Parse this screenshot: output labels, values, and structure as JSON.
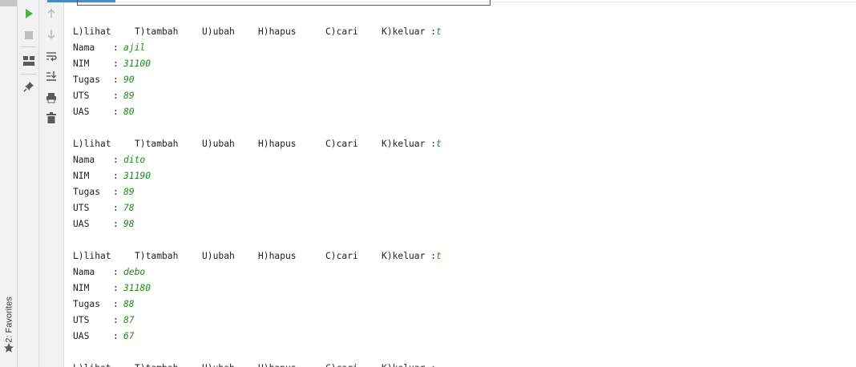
{
  "favorites": {
    "label": "2: Favorites",
    "icon": "star-icon"
  },
  "toolbar_left": [
    {
      "name": "run-button",
      "icon": "play-icon",
      "color": "#4caf50"
    },
    {
      "name": "stop-button",
      "icon": "stop-icon",
      "color": "#bdbdbd"
    },
    {
      "name": "layout-button",
      "icon": "layout-icon"
    },
    {
      "name": "pin-button",
      "icon": "pin-icon"
    }
  ],
  "toolbar_right": [
    {
      "name": "scroll-up-button",
      "icon": "arrow-up-icon"
    },
    {
      "name": "scroll-down-button",
      "icon": "arrow-down-icon"
    },
    {
      "name": "soft-wrap-button",
      "icon": "soft-wrap-icon"
    },
    {
      "name": "scroll-to-end-button",
      "icon": "scroll-to-end-icon"
    },
    {
      "name": "print-button",
      "icon": "print-icon"
    },
    {
      "name": "clear-all-button",
      "icon": "trash-icon"
    }
  ],
  "menu": {
    "lihat": "L)lihat",
    "tambah": "T)tambah",
    "ubah": "U)ubah",
    "hapus": "H)hapus",
    "cari": "C)cari",
    "keluar": "K)keluar :"
  },
  "labels": {
    "nama": "Nama",
    "nim": "NIM",
    "tugas": "Tugas",
    "uts": "UTS",
    "uas": "UAS",
    "colon": ":"
  },
  "records": [
    {
      "choice": "t",
      "nama": "ajil",
      "nim": "31100",
      "tugas": "90",
      "uts": "89",
      "uas": "80"
    },
    {
      "choice": "t",
      "nama": "dito",
      "nim": "31190",
      "tugas": "89",
      "uts": "78",
      "uas": "98"
    },
    {
      "choice": "t",
      "nama": "debo",
      "nim": "31180",
      "tugas": "88",
      "uts": "87",
      "uas": "67"
    }
  ],
  "colors": {
    "input_text": "#1a8a1a",
    "accent_tab": "#4a88c7"
  }
}
